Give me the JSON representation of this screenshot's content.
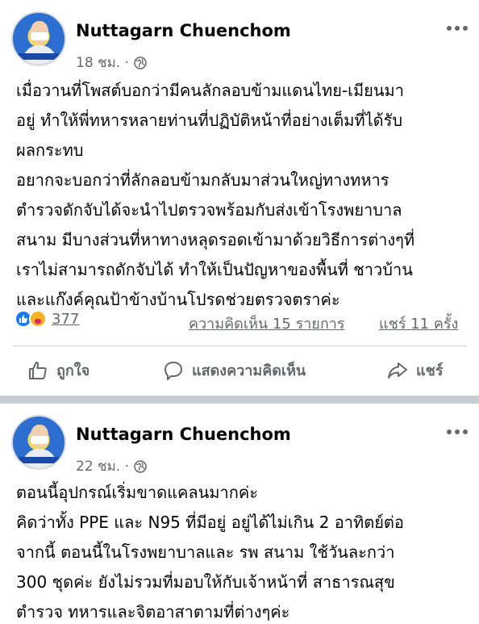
{
  "posts": [
    {
      "author": "Nuttagarn Chuenchom",
      "time": "18 ชม. ·",
      "privacy_icon": "globe-icon",
      "more_icon": "more-options-icon",
      "lines": [
        "เมื่อวานที่โพสต์บอกว่ามีคนลักลอบข้ามแดนไทย-เมียนมา",
        "อยู่ ทำให้พี่ทหารหลายท่านที่ปฏิบัติหน้าที่อย่างเต็มที่ได้รับ",
        "ผลกระทบ",
        "อยากจะบอกว่าที่ลักลอบข้ามกลับมาส่วนใหญ่ทางทหาร",
        "ตำรวจดักจับได้จะนำไปตรวจพร้อมกับส่งเข้าโรงพยาบาล",
        "สนาม มีบางส่วนที่หาทางหลุดรอดเข้ามาด้วยวิธีการต่างๆที่",
        "เราไม่สามารถดักจับได้ ทำให้เป็นปัญหาของพื้นที่ ชาวบ้าน",
        "และแก๊งค์คุณป้าข้างบ้านโปรดช่วยตรวจตราค่ะ"
      ],
      "reaction_count": "377",
      "comments_count": "ความคิดเห็น 15 รายการ",
      "shares_count": "แชร์ 11 ครั้ง",
      "actions": {
        "like": "ถูกใจ",
        "comment": "แสดงความคิดเห็น",
        "share": "แชร์"
      }
    },
    {
      "author": "Nuttagarn Chuenchom",
      "time": "22 ชม. ·",
      "privacy_icon": "globe-icon",
      "more_icon": "more-options-icon",
      "lines": [
        "ตอนนี้อุปกรณ์เริ่มขาดแคลนมากค่ะ",
        "คิดว่าทั้ง PPE และ N95 ที่มีอยู่ อยู่ได้ไม่เกิน 2 อาทิตย์ต่อ",
        "จากนี้ ตอนนี้ในโรงพยาบาลและ รพ สนาม ใช้วันละกว่า",
        "300 ชุดค่ะ ยังไม่รวมที่มอบให้กับเจ้าหน้าที่ สาธารณสุข",
        "ตำรวจ ทหารและจิตอาสาตามที่ต่างๆค่ะ"
      ]
    }
  ],
  "colors": {
    "text": "#050505",
    "secondary": "#65676b",
    "like_blue": "#1877f2",
    "care_yellow": "#f7b125",
    "separator": "#c9ccd1"
  }
}
